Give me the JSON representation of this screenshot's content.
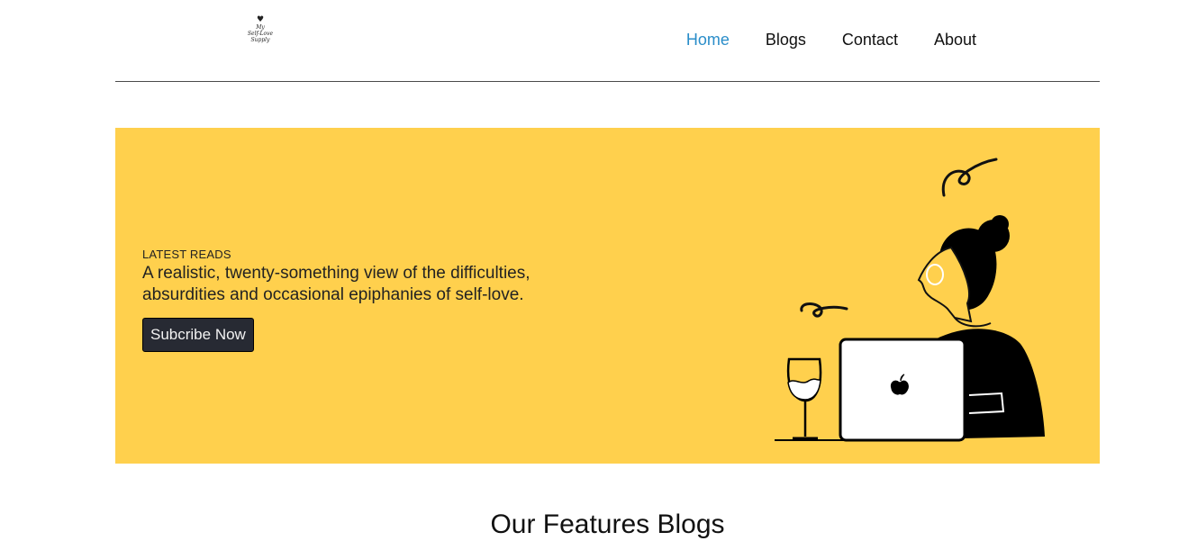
{
  "logo": {
    "lines": [
      "My",
      "Self-Love",
      "Supply"
    ],
    "icon": "heart-icon"
  },
  "nav": {
    "items": [
      {
        "label": "Home",
        "active": true
      },
      {
        "label": "Blogs",
        "active": false
      },
      {
        "label": "Contact",
        "active": false
      },
      {
        "label": "About",
        "active": false
      }
    ],
    "active_color": "#2a8dc9"
  },
  "hero": {
    "eyebrow": "LATEST READS",
    "headline": "A realistic, twenty-something view of the difficulties, absurdities and occasional epiphanies of self-love.",
    "button_label": "Subcribe Now",
    "background_color": "#ffd04d",
    "illustration": "woman-with-laptop-and-wine-illustration"
  },
  "features": {
    "title": "Our Features Blogs"
  }
}
